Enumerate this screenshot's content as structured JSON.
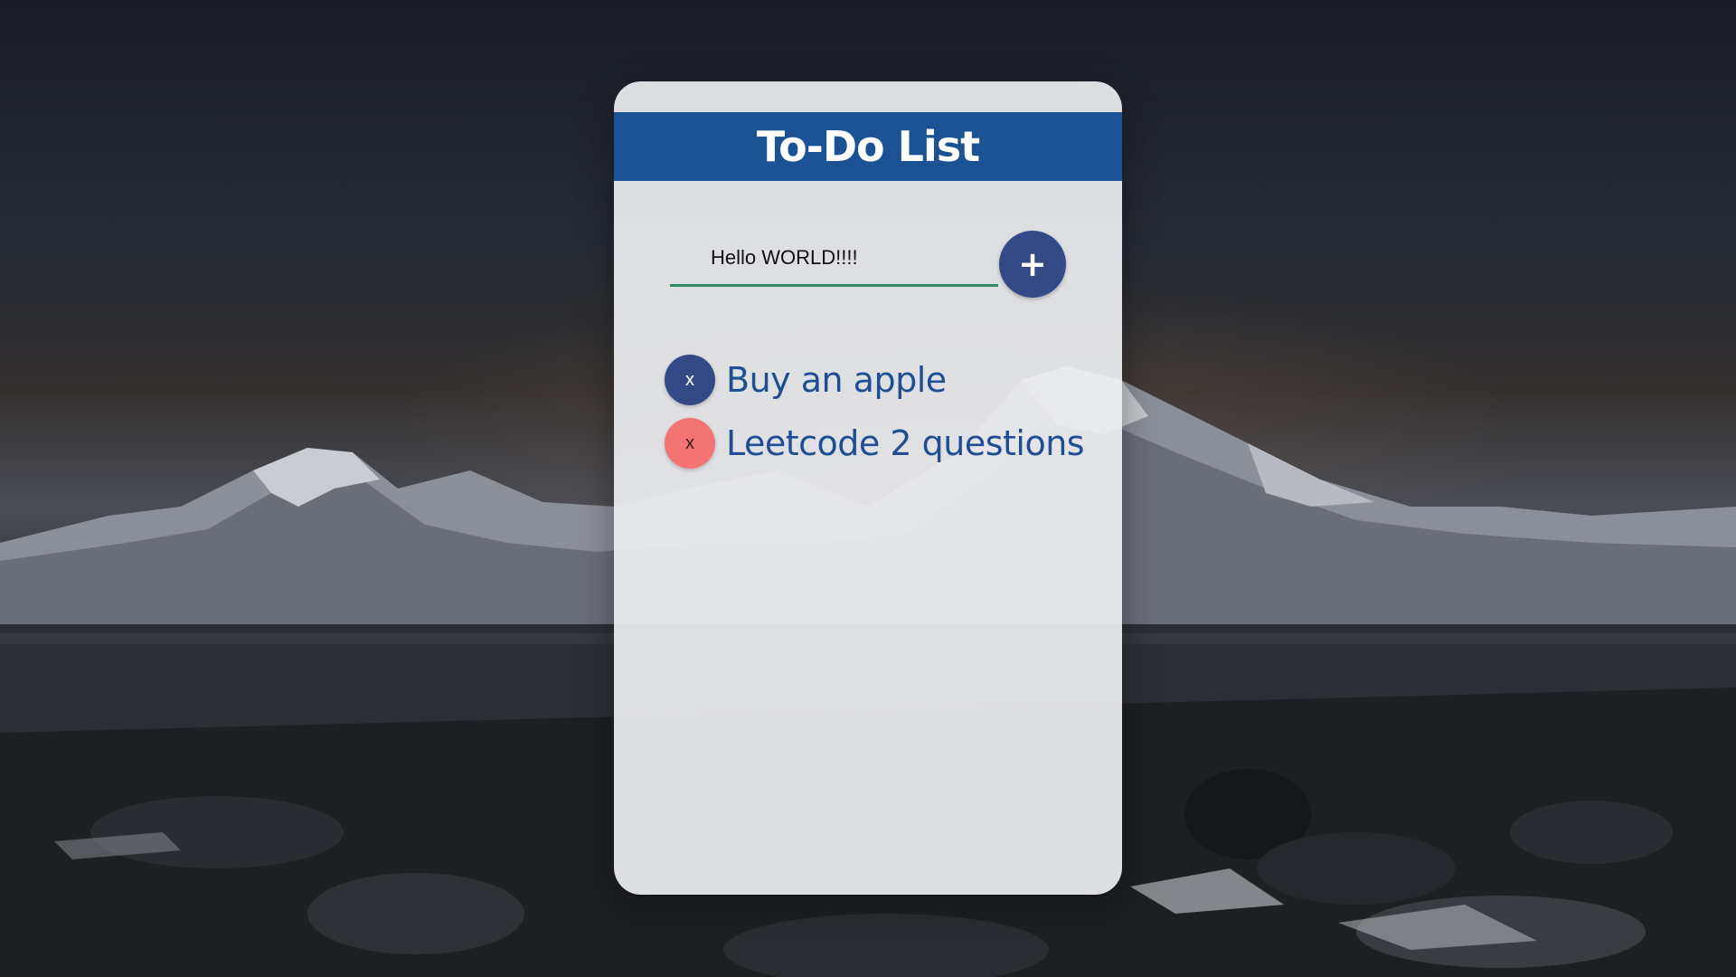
{
  "app": {
    "title": "To-Do List"
  },
  "input": {
    "value": "Hello WORLD!!!!",
    "add_label": "+"
  },
  "todos": [
    {
      "text": "Buy an apple",
      "delete_label": "x",
      "button_color": "#334a86",
      "delete_text_color": "#ffffff"
    },
    {
      "text": "Leetcode 2 questions",
      "delete_label": "x",
      "button_color": "#f47373",
      "delete_text_color": "#3a1a1a"
    }
  ],
  "colors": {
    "header": "#1a5293",
    "accent_underline": "#2e8b64",
    "add_button": "#334a86",
    "todo_text": "#1f4e93"
  }
}
